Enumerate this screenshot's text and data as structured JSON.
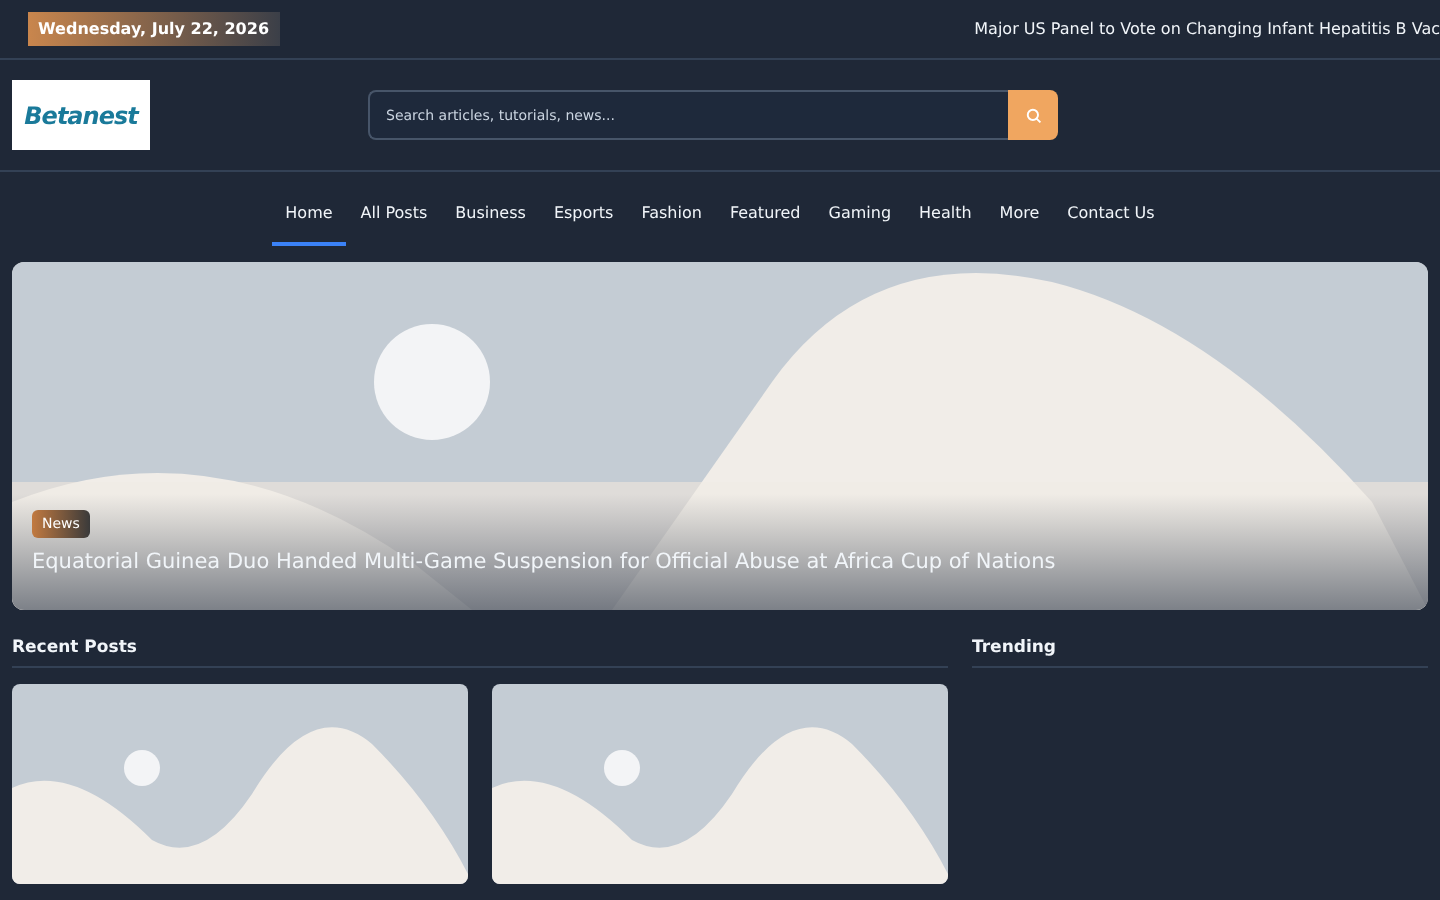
{
  "top_bar": {
    "date": "Wednesday, July 22, 2026",
    "ticker": "Major US Panel to Vote on Changing Infant Hepatitis B Vac"
  },
  "header": {
    "logo": "Betanest",
    "search": {
      "placeholder": "Search articles, tutorials, news..."
    }
  },
  "nav": [
    {
      "label": "Home",
      "selected": true
    },
    {
      "label": "All Posts",
      "selected": false
    },
    {
      "label": "Business",
      "selected": false
    },
    {
      "label": "Esports",
      "selected": false
    },
    {
      "label": "Fashion",
      "selected": false
    },
    {
      "label": "Featured",
      "selected": false
    },
    {
      "label": "Gaming",
      "selected": false
    },
    {
      "label": "Health",
      "selected": false
    },
    {
      "label": "More",
      "selected": false
    },
    {
      "label": "Contact Us",
      "selected": false
    }
  ],
  "hero": {
    "kind": "picture",
    "category": "News",
    "title": "Equatorial Guinea Duo Handed Multi-Game Suspension for Official Abuse at Africa Cup of Nations"
  },
  "recent_posts": {
    "heading": "Recent Posts"
  },
  "trending": {
    "heading": "Trending"
  }
}
